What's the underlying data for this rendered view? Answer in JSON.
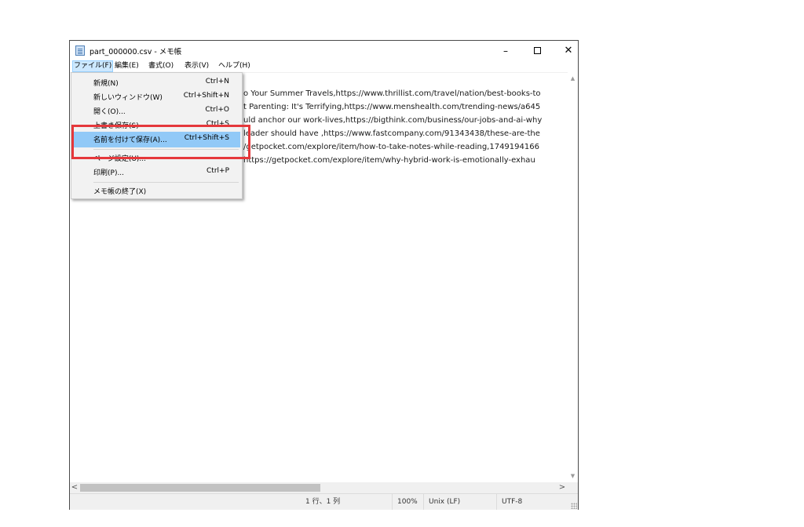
{
  "window": {
    "title": "part_000000.csv - メモ帳",
    "minimize": "–",
    "close": "✕"
  },
  "menubar": [
    "ファイル(F)",
    "編集(E)",
    "書式(O)",
    "表示(V)",
    "ヘルプ(H)"
  ],
  "editor_lines": [
    "o Your Summer Travels,https://www.thrillist.com/travel/nation/best-books-to",
    "t Parenting: It's Terrifying,https://www.menshealth.com/trending-news/a645",
    "uld anchor our work-lives,https://bigthink.com/business/our-jobs-and-ai-why",
    "leader should have ,https://www.fastcompany.com/91343438/these-are-the",
    "/getpocket.com/explore/item/how-to-take-notes-while-reading,1749194166",
    "https://getpocket.com/explore/item/why-hybrid-work-is-emotionally-exhau"
  ],
  "file_menu": {
    "items": [
      {
        "label": "新規(N)",
        "shortcut": "Ctrl+N"
      },
      {
        "label": "新しいウィンドウ(W)",
        "shortcut": "Ctrl+Shift+N"
      },
      {
        "label": "開く(O)...",
        "shortcut": "Ctrl+O"
      },
      {
        "label": "上書き保存(S)",
        "shortcut": "Ctrl+S"
      },
      {
        "label": "名前を付けて保存(A)...",
        "shortcut": "Ctrl+Shift+S"
      },
      {
        "label": "ページ設定(U)...",
        "shortcut": ""
      },
      {
        "label": "印刷(P)...",
        "shortcut": "Ctrl+P"
      },
      {
        "label": "メモ帳の終了(X)",
        "shortcut": ""
      }
    ]
  },
  "statusbar": {
    "position": "1 行、1 列",
    "zoom": "100%",
    "line_ending": "Unix (LF)",
    "encoding": "UTF-8"
  },
  "scroll_arrows": {
    "up": "▲",
    "down": "▼",
    "left": "<",
    "right": ">"
  },
  "colors": {
    "highlight_box": "#e5383b",
    "menu_hover": "#91c9f7",
    "active_menu": "#cce8ff"
  }
}
